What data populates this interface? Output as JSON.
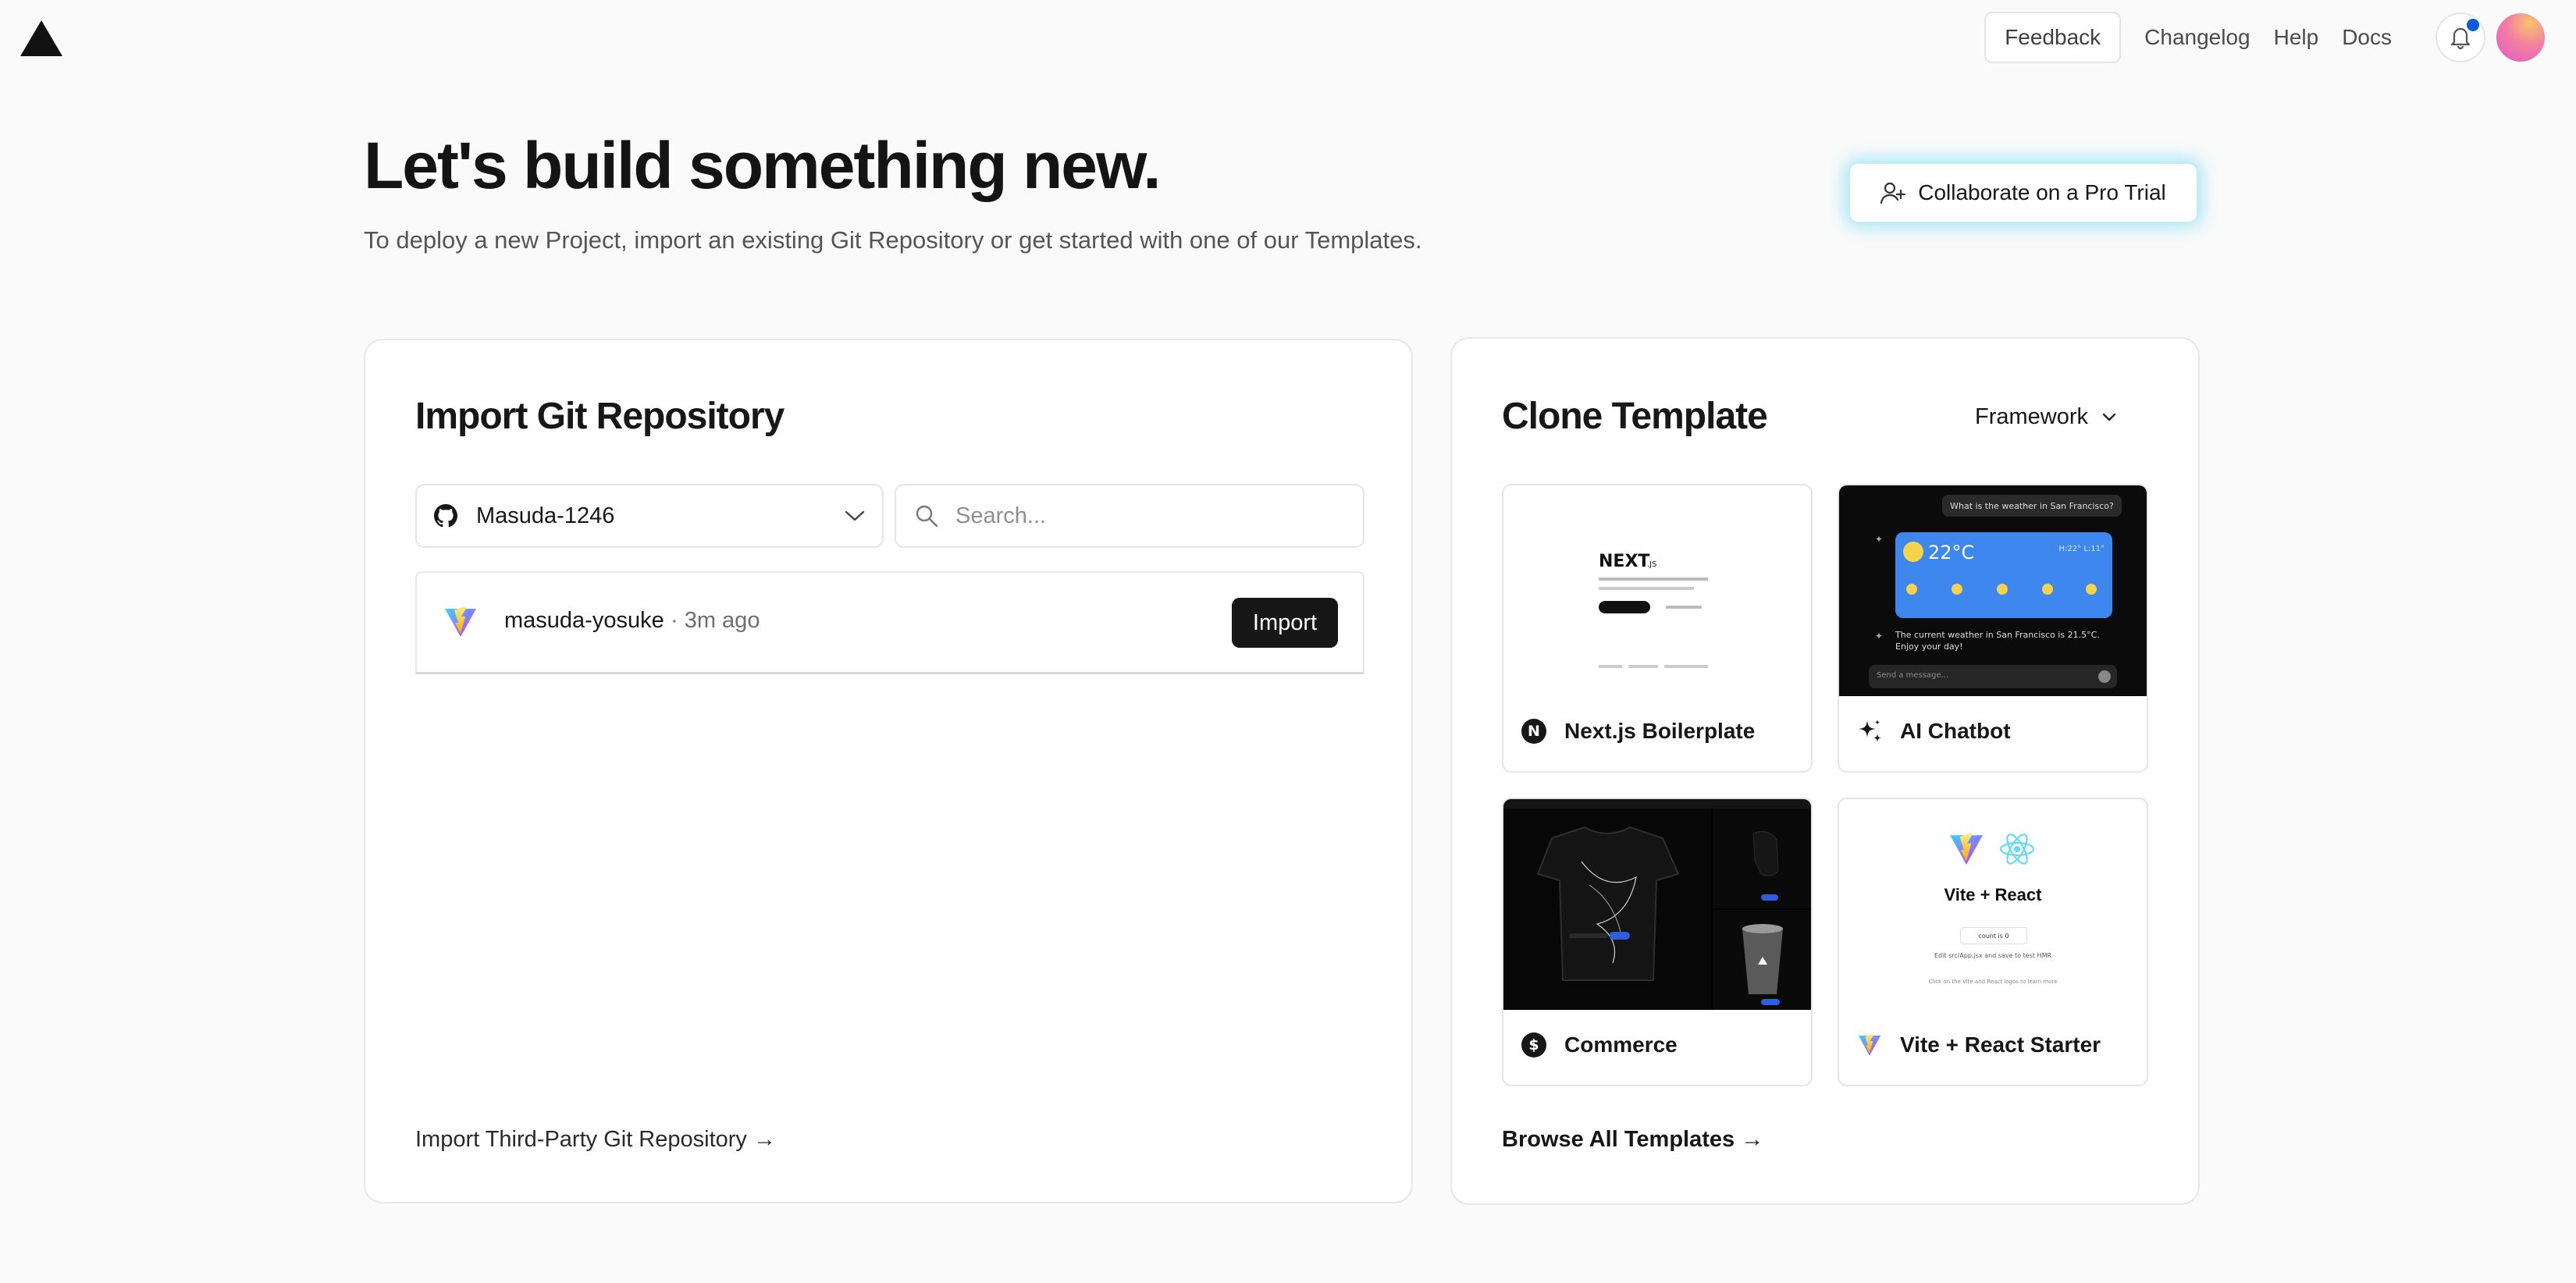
{
  "nav": {
    "feedback_label": "Feedback",
    "changelog_label": "Changelog",
    "help_label": "Help",
    "docs_label": "Docs"
  },
  "hero": {
    "title": "Let's build something new.",
    "subtitle": "To deploy a new Project, import an existing Git Repository or get started with one of our Templates.",
    "pro_trial_label": "Collaborate on a Pro Trial"
  },
  "import": {
    "title": "Import Git Repository",
    "account": "Masuda-1246",
    "search_placeholder": "Search...",
    "repos": [
      {
        "name": "masuda-yosuke",
        "time": " · 3m ago",
        "action_label": "Import"
      }
    ],
    "third_party_label": "Import Third-Party Git Repository →"
  },
  "clone": {
    "title": "Clone Template",
    "framework_label": "Framework",
    "templates": [
      {
        "label": "Next.js Boilerplate",
        "icon": "nextjs-icon"
      },
      {
        "label": "AI Chatbot",
        "icon": "sparkles-icon"
      },
      {
        "label": "Commerce",
        "icon": "dollar-icon"
      },
      {
        "label": "Vite + React Starter",
        "icon": "vite-icon"
      }
    ],
    "browse_label": "Browse All Templates →",
    "chatbot_preview": {
      "question": "What is the weather in San Francisco?",
      "temperature": "22°C",
      "hilo": "H:22° L:11°",
      "answer": "The current weather in San Francisco is 21.5°C. Enjoy your day!",
      "input_placeholder": "Send a message..."
    },
    "vite_preview": {
      "heading": "Vite + React",
      "count": "count is 0",
      "edit_text": "Edit src/App.jsx and save to test HMR",
      "docs_text": "Click on the Vite and React logos to learn more"
    }
  },
  "colors": {
    "accent_blue": "#0a5be0",
    "pro_glow": "#2dcdf0",
    "text_primary": "#171717"
  }
}
